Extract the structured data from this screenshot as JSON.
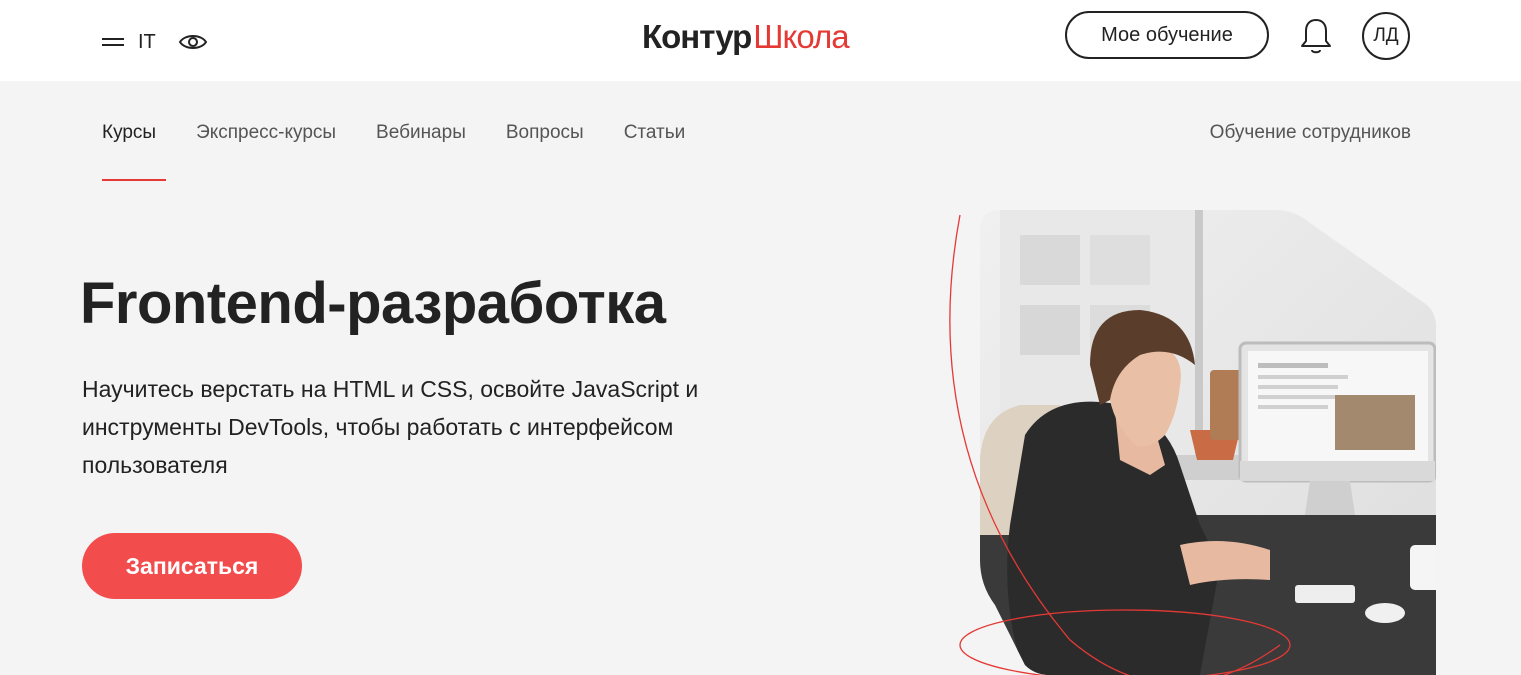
{
  "header": {
    "category_label": "IT",
    "logo_primary": "Контур",
    "logo_secondary": "Школа",
    "my_learning_label": "Мое обучение",
    "avatar_initials": "ЛД"
  },
  "nav": {
    "items": [
      {
        "label": "Курсы",
        "active": true
      },
      {
        "label": "Экспресс-курсы",
        "active": false
      },
      {
        "label": "Вебинары",
        "active": false
      },
      {
        "label": "Вопросы",
        "active": false
      },
      {
        "label": "Статьи",
        "active": false
      }
    ],
    "right_link": "Обучение сотрудников"
  },
  "hero": {
    "title": "Frontend-разработка",
    "description": "Научитесь верстать на HTML и CSS, освойте JavaScript и инструменты DevTools, чтобы работать с интерфейсом пользователя",
    "cta_label": "Записаться"
  },
  "icons": {
    "menu": "menu-icon",
    "accessibility": "eye-icon",
    "notifications": "bell-icon"
  },
  "colors": {
    "accent": "#e53935",
    "cta": "#f24c4c",
    "header_bg": "#ffffff",
    "page_bg": "#f4f4f4"
  }
}
